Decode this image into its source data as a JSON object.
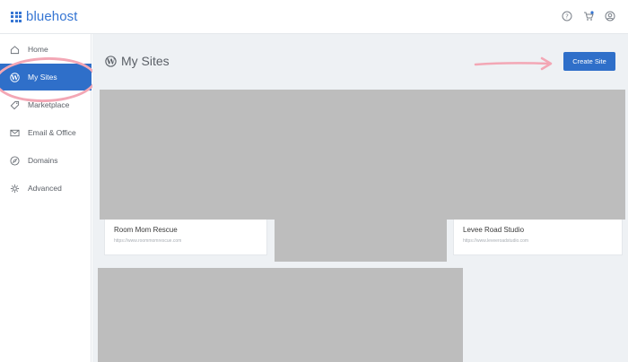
{
  "brand": {
    "name": "bluehost",
    "color": "#3575d3"
  },
  "topbar": {
    "icons": [
      "help-icon",
      "cart-icon",
      "account-icon"
    ]
  },
  "sidebar": {
    "active_color": "#2f6fc9",
    "items": [
      {
        "label": "Home",
        "icon": "home-icon"
      },
      {
        "label": "My Sites",
        "icon": "wordpress-icon",
        "active": true
      },
      {
        "label": "Marketplace",
        "icon": "tag-icon"
      },
      {
        "label": "Email & Office",
        "icon": "mail-icon"
      },
      {
        "label": "Domains",
        "icon": "compass-icon"
      },
      {
        "label": "Advanced",
        "icon": "gear-icon"
      }
    ]
  },
  "main": {
    "title": "My Sites",
    "create_button": "Create Site",
    "annotation_color": "#f3a7b5",
    "sites": [
      {
        "name": "Room Mom Rescue",
        "url": "https://www.roommomrescue.com"
      },
      {
        "name": "Levee Road Studio",
        "url": "https://www.leveeroadstudio.com"
      }
    ]
  }
}
